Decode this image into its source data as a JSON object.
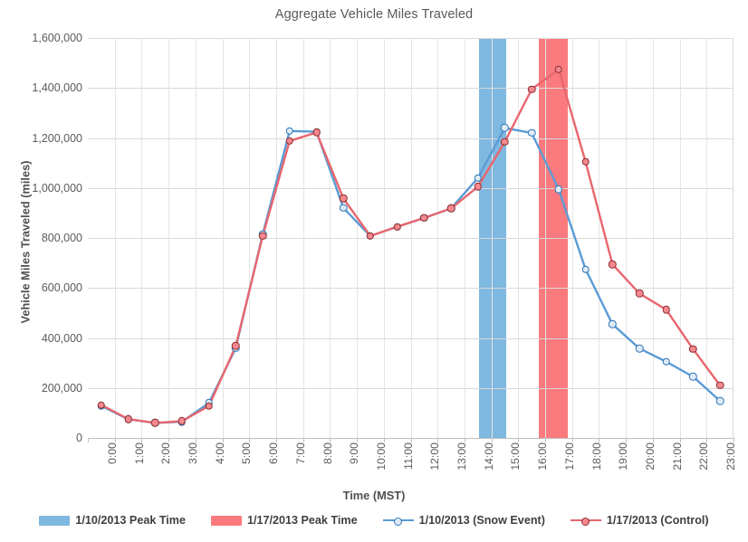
{
  "chart_data": {
    "type": "line",
    "title": "Aggregate Vehicle Miles Traveled",
    "xlabel": "Time (MST)",
    "ylabel": "Vehicle Miles Traveled (miles)",
    "categories": [
      "0:00",
      "1:00",
      "2:00",
      "3:00",
      "4:00",
      "5:00",
      "6:00",
      "7:00",
      "8:00",
      "9:00",
      "10:00",
      "11:00",
      "12:00",
      "13:00",
      "14:00",
      "15:00",
      "16:00",
      "17:00",
      "18:00",
      "19:00",
      "20:00",
      "21:00",
      "22:00",
      "23:00"
    ],
    "ylim": [
      0,
      1600000
    ],
    "ytick_step": 200000,
    "ytick_labels": [
      "0",
      "200,000",
      "400,000",
      "600,000",
      "800,000",
      "1,000,000",
      "1,200,000",
      "1,400,000",
      "1,600,000"
    ],
    "grid": "horizontal-and-vertical",
    "legend_position": "bottom",
    "series": [
      {
        "name": "1/10/2013 (Snow Event)",
        "color": "#5B9BD5",
        "marker_fill": "#DEEBF7",
        "values": [
          128000,
          75000,
          60000,
          65000,
          140000,
          360000,
          815000,
          1228000,
          1225000,
          920000,
          808000,
          845000,
          880000,
          918000,
          1040000,
          1240000,
          1220000,
          995000,
          675000,
          455000,
          358000,
          305000,
          245000,
          148000
        ]
      },
      {
        "name": "1/17/2013 (Control)",
        "color": "#E8666E",
        "marker_fill": "#F4888E",
        "values": [
          132000,
          76000,
          60000,
          67000,
          128000,
          368000,
          808000,
          1188000,
          1222000,
          958000,
          808000,
          845000,
          880000,
          918000,
          1005000,
          1185000,
          1395000,
          1475000,
          1105000,
          695000,
          578000,
          513000,
          355000,
          210000
        ]
      }
    ],
    "bands": [
      {
        "name": "1/10/2013 Peak Time",
        "color": "#7FB8E0",
        "start_hour": 14.55,
        "end_hour": 15.55
      },
      {
        "name": "1/17/2013 Peak Time",
        "color": "#FA7A7E",
        "start_hour": 16.75,
        "end_hour": 17.85
      }
    ]
  },
  "legend": {
    "items": [
      {
        "label": "1/10/2013 Peak Time",
        "style": "box",
        "color": "#7FB8E0"
      },
      {
        "label": "1/17/2013 Peak Time",
        "style": "box",
        "color": "#FA7A7E"
      },
      {
        "label": "1/10/2013 (Snow Event)",
        "style": "line",
        "color": "#5B9BD5"
      },
      {
        "label": "1/17/2013 (Control)",
        "style": "line",
        "color": "#E8666E"
      }
    ]
  }
}
